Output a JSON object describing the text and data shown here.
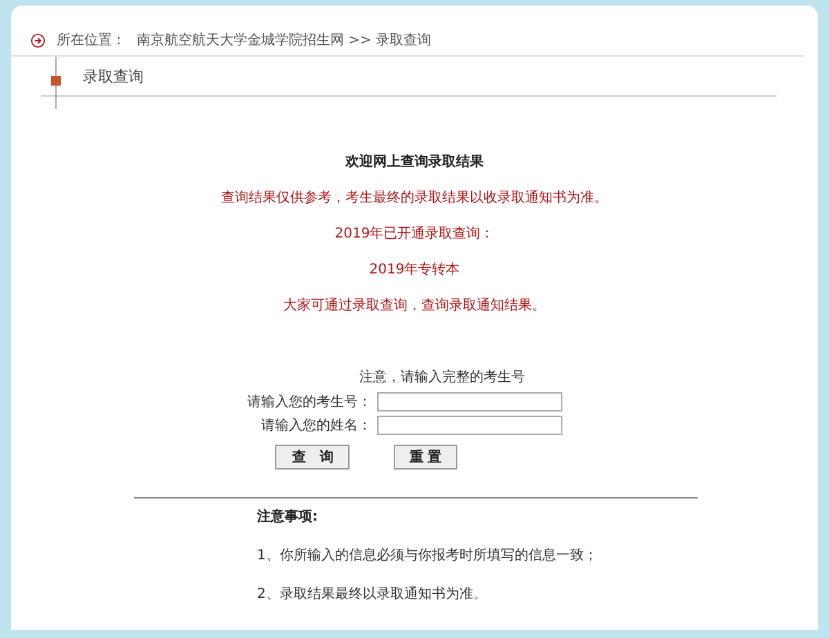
{
  "breadcrumb": {
    "label": "所在位置：",
    "path": "南京航空航天大学金城学院招生网 >> 录取查询"
  },
  "section_title": "录取查询",
  "intro": {
    "title": "欢迎网上查询录取结果",
    "lines": [
      "查询结果仅供参考，考生最终的录取结果以收录取通知书为准。",
      "2019年已开通录取查询：",
      "2019年专转本",
      "大家可通过录取查询，查询录取通知结果。"
    ]
  },
  "form": {
    "hint": "注意，请输入完整的考生号",
    "fields": [
      {
        "label": "请输入您的考生号："
      },
      {
        "label": "请输入您的姓名："
      }
    ],
    "buttons": [
      "查　询",
      "重 置"
    ]
  },
  "notes": {
    "title": "注意事项:",
    "items": [
      "1、你所输入的信息必须与你报考时所填写的信息一致；",
      "2、录取结果最终以录取通知书为准。"
    ]
  }
}
